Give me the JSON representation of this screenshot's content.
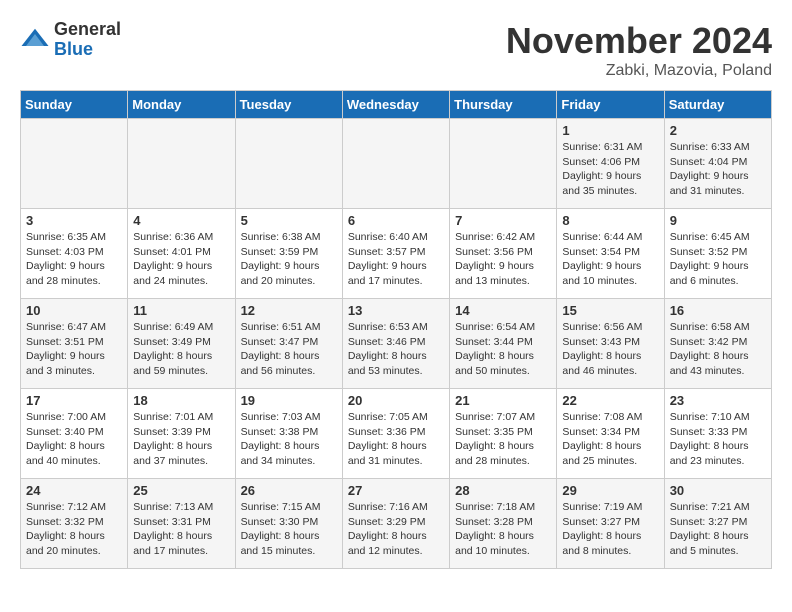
{
  "header": {
    "logo_general": "General",
    "logo_blue": "Blue",
    "month_title": "November 2024",
    "subtitle": "Zabki, Mazovia, Poland"
  },
  "days_of_week": [
    "Sunday",
    "Monday",
    "Tuesday",
    "Wednesday",
    "Thursday",
    "Friday",
    "Saturday"
  ],
  "weeks": [
    [
      {
        "day": "",
        "info": ""
      },
      {
        "day": "",
        "info": ""
      },
      {
        "day": "",
        "info": ""
      },
      {
        "day": "",
        "info": ""
      },
      {
        "day": "",
        "info": ""
      },
      {
        "day": "1",
        "info": "Sunrise: 6:31 AM\nSunset: 4:06 PM\nDaylight: 9 hours and 35 minutes."
      },
      {
        "day": "2",
        "info": "Sunrise: 6:33 AM\nSunset: 4:04 PM\nDaylight: 9 hours and 31 minutes."
      }
    ],
    [
      {
        "day": "3",
        "info": "Sunrise: 6:35 AM\nSunset: 4:03 PM\nDaylight: 9 hours and 28 minutes."
      },
      {
        "day": "4",
        "info": "Sunrise: 6:36 AM\nSunset: 4:01 PM\nDaylight: 9 hours and 24 minutes."
      },
      {
        "day": "5",
        "info": "Sunrise: 6:38 AM\nSunset: 3:59 PM\nDaylight: 9 hours and 20 minutes."
      },
      {
        "day": "6",
        "info": "Sunrise: 6:40 AM\nSunset: 3:57 PM\nDaylight: 9 hours and 17 minutes."
      },
      {
        "day": "7",
        "info": "Sunrise: 6:42 AM\nSunset: 3:56 PM\nDaylight: 9 hours and 13 minutes."
      },
      {
        "day": "8",
        "info": "Sunrise: 6:44 AM\nSunset: 3:54 PM\nDaylight: 9 hours and 10 minutes."
      },
      {
        "day": "9",
        "info": "Sunrise: 6:45 AM\nSunset: 3:52 PM\nDaylight: 9 hours and 6 minutes."
      }
    ],
    [
      {
        "day": "10",
        "info": "Sunrise: 6:47 AM\nSunset: 3:51 PM\nDaylight: 9 hours and 3 minutes."
      },
      {
        "day": "11",
        "info": "Sunrise: 6:49 AM\nSunset: 3:49 PM\nDaylight: 8 hours and 59 minutes."
      },
      {
        "day": "12",
        "info": "Sunrise: 6:51 AM\nSunset: 3:47 PM\nDaylight: 8 hours and 56 minutes."
      },
      {
        "day": "13",
        "info": "Sunrise: 6:53 AM\nSunset: 3:46 PM\nDaylight: 8 hours and 53 minutes."
      },
      {
        "day": "14",
        "info": "Sunrise: 6:54 AM\nSunset: 3:44 PM\nDaylight: 8 hours and 50 minutes."
      },
      {
        "day": "15",
        "info": "Sunrise: 6:56 AM\nSunset: 3:43 PM\nDaylight: 8 hours and 46 minutes."
      },
      {
        "day": "16",
        "info": "Sunrise: 6:58 AM\nSunset: 3:42 PM\nDaylight: 8 hours and 43 minutes."
      }
    ],
    [
      {
        "day": "17",
        "info": "Sunrise: 7:00 AM\nSunset: 3:40 PM\nDaylight: 8 hours and 40 minutes."
      },
      {
        "day": "18",
        "info": "Sunrise: 7:01 AM\nSunset: 3:39 PM\nDaylight: 8 hours and 37 minutes."
      },
      {
        "day": "19",
        "info": "Sunrise: 7:03 AM\nSunset: 3:38 PM\nDaylight: 8 hours and 34 minutes."
      },
      {
        "day": "20",
        "info": "Sunrise: 7:05 AM\nSunset: 3:36 PM\nDaylight: 8 hours and 31 minutes."
      },
      {
        "day": "21",
        "info": "Sunrise: 7:07 AM\nSunset: 3:35 PM\nDaylight: 8 hours and 28 minutes."
      },
      {
        "day": "22",
        "info": "Sunrise: 7:08 AM\nSunset: 3:34 PM\nDaylight: 8 hours and 25 minutes."
      },
      {
        "day": "23",
        "info": "Sunrise: 7:10 AM\nSunset: 3:33 PM\nDaylight: 8 hours and 23 minutes."
      }
    ],
    [
      {
        "day": "24",
        "info": "Sunrise: 7:12 AM\nSunset: 3:32 PM\nDaylight: 8 hours and 20 minutes."
      },
      {
        "day": "25",
        "info": "Sunrise: 7:13 AM\nSunset: 3:31 PM\nDaylight: 8 hours and 17 minutes."
      },
      {
        "day": "26",
        "info": "Sunrise: 7:15 AM\nSunset: 3:30 PM\nDaylight: 8 hours and 15 minutes."
      },
      {
        "day": "27",
        "info": "Sunrise: 7:16 AM\nSunset: 3:29 PM\nDaylight: 8 hours and 12 minutes."
      },
      {
        "day": "28",
        "info": "Sunrise: 7:18 AM\nSunset: 3:28 PM\nDaylight: 8 hours and 10 minutes."
      },
      {
        "day": "29",
        "info": "Sunrise: 7:19 AM\nSunset: 3:27 PM\nDaylight: 8 hours and 8 minutes."
      },
      {
        "day": "30",
        "info": "Sunrise: 7:21 AM\nSunset: 3:27 PM\nDaylight: 8 hours and 5 minutes."
      }
    ]
  ]
}
